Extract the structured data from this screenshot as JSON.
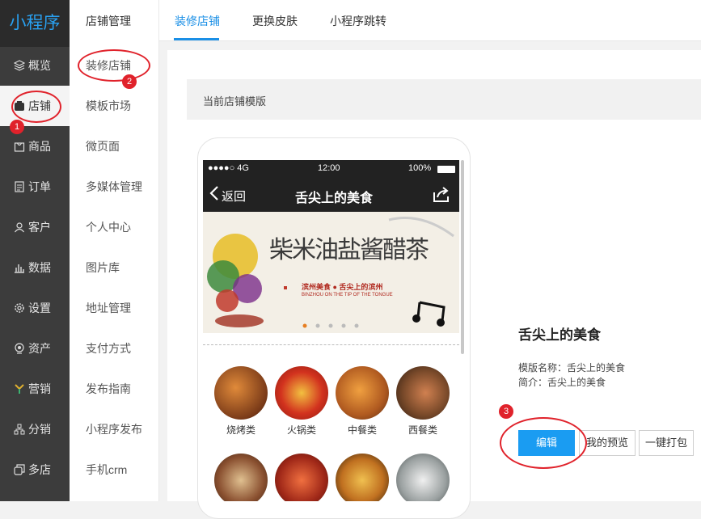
{
  "app": {
    "logo": "小程序"
  },
  "sidebar": {
    "items": [
      {
        "label": "概览",
        "icon": "layers-icon"
      },
      {
        "label": "店铺",
        "icon": "store-icon"
      },
      {
        "label": "商品",
        "icon": "bag-icon"
      },
      {
        "label": "订单",
        "icon": "order-icon"
      },
      {
        "label": "客户",
        "icon": "user-icon"
      },
      {
        "label": "数据",
        "icon": "bar-chart-icon"
      },
      {
        "label": "设置",
        "icon": "gear-icon"
      },
      {
        "label": "资产",
        "icon": "asset-icon"
      },
      {
        "label": "营销",
        "icon": "marketing-icon"
      },
      {
        "label": "分销",
        "icon": "distribution-icon"
      },
      {
        "label": "多店",
        "icon": "multistore-icon"
      }
    ],
    "active": "店铺"
  },
  "subnav": {
    "title": "店铺管理",
    "items": [
      "装修店铺",
      "模板市场",
      "微页面",
      "多媒体管理",
      "个人中心",
      "图片库",
      "地址管理",
      "支付方式",
      "发布指南",
      "小程序发布",
      "手机crm"
    ]
  },
  "tabs": [
    "装修店铺",
    "更换皮肤",
    "小程序跳转"
  ],
  "template": {
    "header": "当前店铺模版"
  },
  "phone": {
    "status": {
      "signal": "●●●●○ 4G",
      "time": "12:00",
      "battery": "100%"
    },
    "appbar": {
      "back": "返回",
      "title": "舌尖上的美食"
    },
    "banner": {
      "calligraphy": "柴米油盐酱醋茶",
      "caption": "滨州美食 ● 舌尖上的滨州",
      "caption_en": "BINZHOU ON THE TIP OF THE TONGUE"
    },
    "categories": [
      "烧烤类",
      "火锅类",
      "中餐类",
      "西餐类"
    ]
  },
  "details": {
    "name": "舌尖上的美食",
    "template_name": "模版名称：舌尖上的美食",
    "intro": "简介：舌尖上的美食"
  },
  "buttons": {
    "edit": "编辑",
    "preview": "我的预览",
    "pack": "一键打包"
  },
  "annotations": [
    "1",
    "2",
    "3"
  ],
  "colors": {
    "accent": "#1a8fe6",
    "sidebar": "#3c3c3c",
    "annotation": "#e0222b"
  }
}
